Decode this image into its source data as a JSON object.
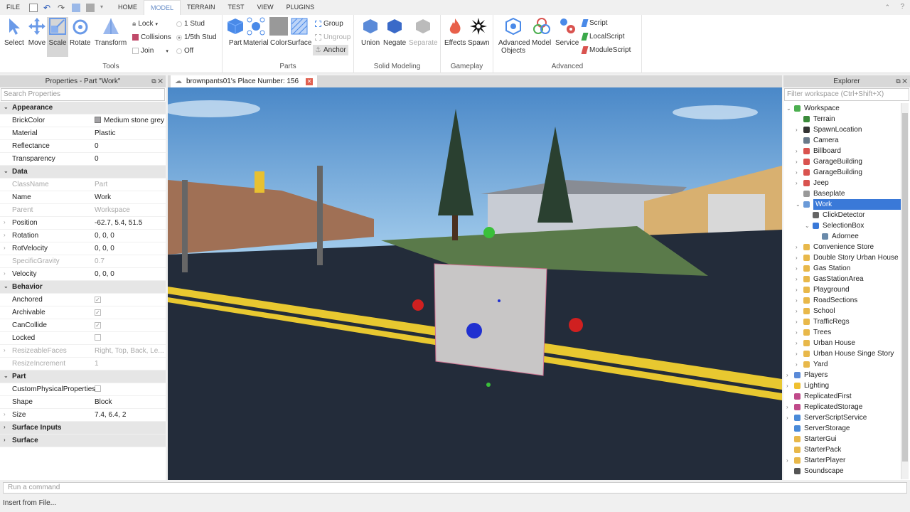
{
  "menu": {
    "file": "FILE",
    "tabs": [
      "HOME",
      "MODEL",
      "TERRAIN",
      "TEST",
      "VIEW",
      "PLUGINS"
    ],
    "active": "MODEL"
  },
  "ribbon": {
    "tools": {
      "label": "Tools",
      "select": "Select",
      "move": "Move",
      "scale": "Scale",
      "rotate": "Rotate",
      "transform": "Transform",
      "lock": "Lock",
      "collisions": "Collisions",
      "join": "Join",
      "stud1": "1 Stud",
      "stud5": "1/5th Stud",
      "off": "Off"
    },
    "parts": {
      "label": "Parts",
      "part": "Part",
      "material": "Material",
      "color": "Color",
      "surface": "Surface",
      "group": "Group",
      "ungroup": "Ungroup",
      "anchor": "Anchor"
    },
    "solid": {
      "label": "Solid Modeling",
      "union": "Union",
      "negate": "Negate",
      "separate": "Separate"
    },
    "gameplay": {
      "label": "Gameplay",
      "effects": "Effects",
      "spawn": "Spawn"
    },
    "advanced": {
      "label": "Advanced",
      "objects": "Advanced Objects",
      "model": "Model",
      "service": "Service",
      "script": "Script",
      "local": "LocalScript",
      "module": "ModuleScript"
    }
  },
  "properties": {
    "title": "Properties - Part \"Work\"",
    "search_placeholder": "Search Properties",
    "rows": [
      {
        "t": "cat",
        "n": "Appearance"
      },
      {
        "n": "BrickColor",
        "v": "Medium stone grey",
        "swatch": "#a3a2a5"
      },
      {
        "n": "Material",
        "v": "Plastic"
      },
      {
        "n": "Reflectance",
        "v": "0"
      },
      {
        "n": "Transparency",
        "v": "0"
      },
      {
        "t": "cat",
        "n": "Data"
      },
      {
        "n": "ClassName",
        "v": "Part",
        "dim": true
      },
      {
        "n": "Name",
        "v": "Work"
      },
      {
        "n": "Parent",
        "v": "Workspace",
        "dim": true
      },
      {
        "n": "Position",
        "v": "-62.7, 5.4, 51.5",
        "exp": true
      },
      {
        "n": "Rotation",
        "v": "0, 0, 0",
        "exp": true
      },
      {
        "n": "RotVelocity",
        "v": "0, 0, 0",
        "exp": true
      },
      {
        "n": "SpecificGravity",
        "v": "0.7",
        "dim": true
      },
      {
        "n": "Velocity",
        "v": "0, 0, 0",
        "exp": true
      },
      {
        "t": "cat",
        "n": "Behavior"
      },
      {
        "n": "Anchored",
        "cb": true
      },
      {
        "n": "Archivable",
        "cb": true
      },
      {
        "n": "CanCollide",
        "cb": true
      },
      {
        "n": "Locked",
        "cb": false
      },
      {
        "n": "ResizeableFaces",
        "v": "Right, Top, Back, Le...",
        "dim": true,
        "exp": true
      },
      {
        "n": "ResizeIncrement",
        "v": "1",
        "dim": true
      },
      {
        "t": "cat",
        "n": "Part"
      },
      {
        "n": "CustomPhysicalProperties",
        "cb": false
      },
      {
        "n": "Shape",
        "v": "Block"
      },
      {
        "n": "Size",
        "v": "7.4, 6.4, 2",
        "exp": true
      },
      {
        "t": "cat",
        "n": "Surface Inputs",
        "closed": true
      },
      {
        "t": "cat",
        "n": "Surface",
        "closed": true
      }
    ]
  },
  "viewport": {
    "tab": "brownpants01's Place Number: 156"
  },
  "explorer": {
    "title": "Explorer",
    "filter_placeholder": "Filter workspace (Ctrl+Shift+X)",
    "items": [
      {
        "l": "Workspace",
        "d": 0,
        "a": "open",
        "c": "#4caf50"
      },
      {
        "l": "Terrain",
        "d": 1,
        "c": "#3a8a3a"
      },
      {
        "l": "SpawnLocation",
        "d": 1,
        "a": "closed",
        "c": "#333"
      },
      {
        "l": "Camera",
        "d": 1,
        "c": "#6a7a8a"
      },
      {
        "l": "Billboard",
        "d": 1,
        "a": "closed",
        "c": "#d9534f"
      },
      {
        "l": "GarageBuilding",
        "d": 1,
        "a": "closed",
        "c": "#d9534f"
      },
      {
        "l": "GarageBuilding",
        "d": 1,
        "a": "closed",
        "c": "#d9534f"
      },
      {
        "l": "Jeep",
        "d": 1,
        "a": "closed",
        "c": "#d9534f"
      },
      {
        "l": "Baseplate",
        "d": 1,
        "c": "#999"
      },
      {
        "l": "Work",
        "d": 1,
        "a": "open",
        "c": "#6a9ad8",
        "sel": true
      },
      {
        "l": "ClickDetector",
        "d": 2,
        "c": "#666"
      },
      {
        "l": "SelectionBox",
        "d": 2,
        "a": "open",
        "c": "#3a79d8"
      },
      {
        "l": "Adornee",
        "d": 3,
        "c": "#6a8aaa"
      },
      {
        "l": "Convenience Store",
        "d": 1,
        "a": "closed",
        "c": "#e8b84a"
      },
      {
        "l": "Double Story Urban House",
        "d": 1,
        "a": "closed",
        "c": "#e8b84a"
      },
      {
        "l": "Gas Station",
        "d": 1,
        "a": "closed",
        "c": "#e8b84a"
      },
      {
        "l": "GasStationArea",
        "d": 1,
        "a": "closed",
        "c": "#e8b84a"
      },
      {
        "l": "Playground",
        "d": 1,
        "a": "closed",
        "c": "#e8b84a"
      },
      {
        "l": "RoadSections",
        "d": 1,
        "a": "closed",
        "c": "#e8b84a"
      },
      {
        "l": "School",
        "d": 1,
        "a": "closed",
        "c": "#e8b84a"
      },
      {
        "l": "TrafficRegs",
        "d": 1,
        "a": "closed",
        "c": "#e8b84a"
      },
      {
        "l": "Trees",
        "d": 1,
        "a": "closed",
        "c": "#e8b84a"
      },
      {
        "l": "Urban House",
        "d": 1,
        "a": "closed",
        "c": "#e8b84a"
      },
      {
        "l": "Urban House Singe Story",
        "d": 1,
        "a": "closed",
        "c": "#e8b84a"
      },
      {
        "l": "Yard",
        "d": 1,
        "a": "closed",
        "c": "#e8b84a"
      },
      {
        "l": "Players",
        "d": 0,
        "a": "closed",
        "c": "#5a8ad8"
      },
      {
        "l": "Lighting",
        "d": 0,
        "a": "closed",
        "c": "#f0c030"
      },
      {
        "l": "ReplicatedFirst",
        "d": 0,
        "c": "#c04a8a"
      },
      {
        "l": "ReplicatedStorage",
        "d": 0,
        "a": "closed",
        "c": "#c04a8a"
      },
      {
        "l": "ServerScriptService",
        "d": 0,
        "a": "closed",
        "c": "#4a8ad8"
      },
      {
        "l": "ServerStorage",
        "d": 0,
        "c": "#4a8ad8"
      },
      {
        "l": "StarterGui",
        "d": 0,
        "c": "#e8b84a"
      },
      {
        "l": "StarterPack",
        "d": 0,
        "c": "#e8b84a"
      },
      {
        "l": "StarterPlayer",
        "d": 0,
        "a": "closed",
        "c": "#e8b84a"
      },
      {
        "l": "Soundscape",
        "d": 0,
        "c": "#555"
      }
    ]
  },
  "command": {
    "placeholder": "Run a command"
  },
  "status": {
    "text": "Insert from File..."
  }
}
